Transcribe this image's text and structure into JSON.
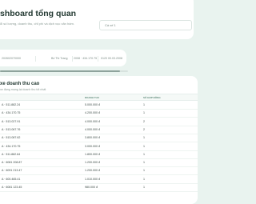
{
  "header": {
    "title": "shboard tổng quan",
    "subtitle": "ổi số lượng, doanh thu, chỉ phí và dịch vục xăn hàm.",
    "filter_placeholder": "Cá xế 1"
  },
  "filters": [
    "202602070000",
    "Bố Thi Trang",
    "2008 · 434.170.75",
    "0120 00.03.2008"
  ],
  "scroll": {
    "position_fraction": 0.0,
    "visible_fraction": 0.94
  },
  "table": {
    "title": "xe doanh thu cao",
    "subtitle": "xe đang mang lại doanh thu tốt nhất",
    "headers": [
      "DOANH THU",
      "SỐ HỢP ĐỒNG"
    ],
    "rows": [
      [
        "A · 511.882.24",
        "5.000.000 đ",
        "1"
      ],
      [
        "A · 434.170.75",
        "4.200.000 đ",
        "1"
      ],
      [
        "A · 513.027.91",
        "4.000.000 đ",
        "2"
      ],
      [
        "A · 513.067.76",
        "4.000.000 đ",
        "2"
      ],
      [
        "A · 513.087.62",
        "3.800.000 đ",
        "1"
      ],
      [
        "A · 434.170.75",
        "3.000.000 đ",
        "1"
      ],
      [
        "A · 511.882.64",
        "1.800.000 đ",
        "1"
      ],
      [
        "A · 6081 208.87",
        "1.200.000 đ",
        "1"
      ],
      [
        "A · 6091 213.47",
        "1.200.000 đ",
        "1"
      ],
      [
        "A · 600.465.41",
        "1.010.000 đ",
        "1"
      ],
      [
        "A · 6081 123.45",
        "980.000 đ",
        "1"
      ]
    ]
  }
}
